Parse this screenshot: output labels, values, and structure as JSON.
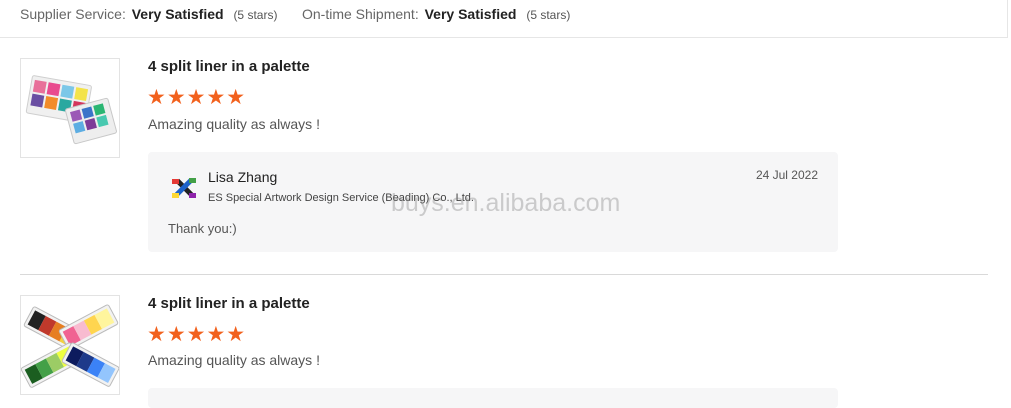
{
  "summary": {
    "supplier_label": "Supplier Service:",
    "supplier_value": "Very Satisfied",
    "supplier_note": "(5 stars)",
    "shipment_label": "On-time Shipment:",
    "shipment_value": "Very Satisfied",
    "shipment_note": "(5 stars)"
  },
  "reviews": [
    {
      "product_title": "4 split liner in a palette",
      "rating": 5,
      "stars": "★★★★★",
      "comment": "Amazing quality as always !",
      "reply": {
        "author": "Lisa Zhang",
        "company": "ES Special Artwork Design Service (Beading) Co., Ltd.",
        "date": "24 Jul 2022",
        "text": "Thank you:)"
      }
    },
    {
      "product_title": "4 split liner in a palette",
      "rating": 5,
      "stars": "★★★★★",
      "comment": "Amazing quality as always !"
    }
  ],
  "watermark": "buys.en.alibaba.com",
  "colors": {
    "star": "#f2611d",
    "reply_bg": "#f6f6f7",
    "divider": "#d9d9d9"
  }
}
